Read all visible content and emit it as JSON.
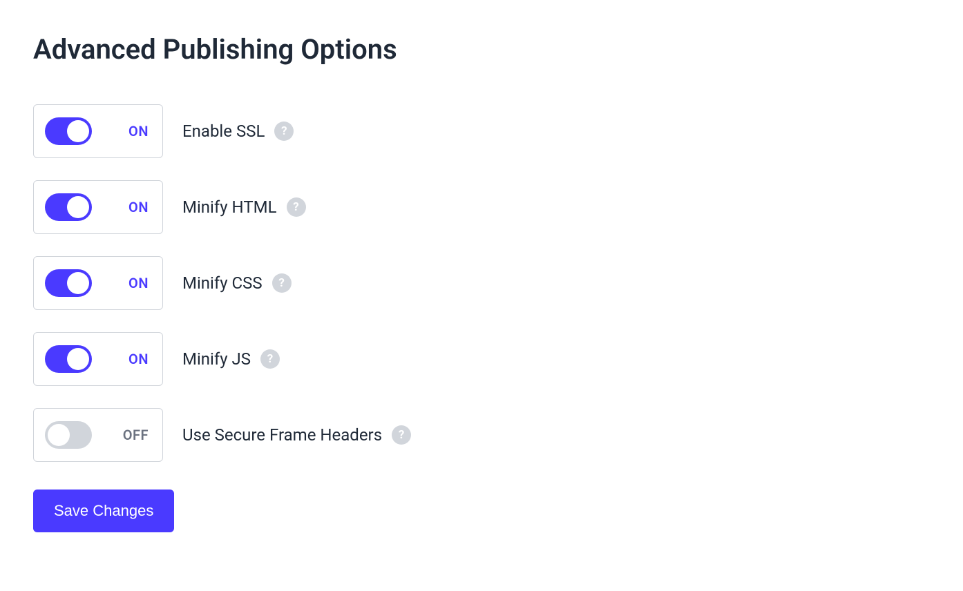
{
  "title": "Advanced Publishing Options",
  "state_labels": {
    "on": "ON",
    "off": "OFF"
  },
  "options": [
    {
      "id": "enable-ssl",
      "label": "Enable SSL",
      "state": "on"
    },
    {
      "id": "minify-html",
      "label": "Minify HTML",
      "state": "on"
    },
    {
      "id": "minify-css",
      "label": "Minify CSS",
      "state": "on"
    },
    {
      "id": "minify-js",
      "label": "Minify JS",
      "state": "on"
    },
    {
      "id": "secure-frame-headers",
      "label": "Use Secure Frame Headers",
      "state": "off"
    }
  ],
  "actions": {
    "save": "Save Changes"
  },
  "help_glyph": "?"
}
